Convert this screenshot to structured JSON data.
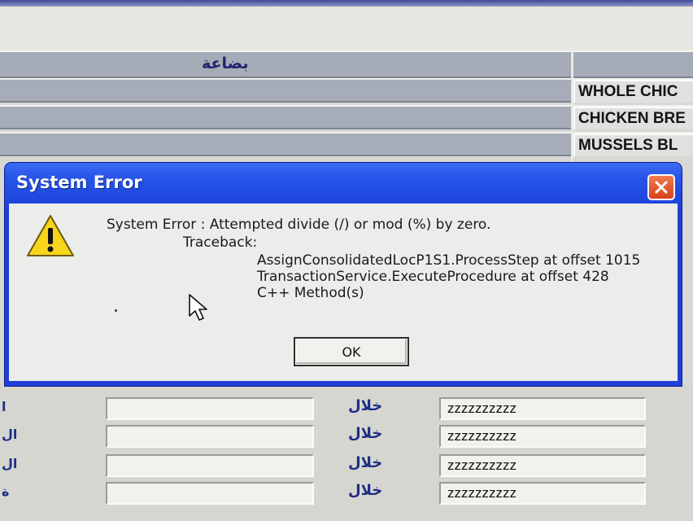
{
  "background_app": {
    "grid_header": "بضاعة",
    "rows": [
      "WHOLE CHIC",
      "CHICKEN BRE",
      "MUSSELS BL"
    ],
    "form_rows": [
      {
        "side_label": "ا",
        "label": "خلال",
        "value": "zzzzzzzzzz"
      },
      {
        "side_label": "ال",
        "label": "خلال",
        "value": "zzzzzzzzzz"
      },
      {
        "side_label": "ال",
        "label": "خلال",
        "value": "zzzzzzzzzz"
      },
      {
        "side_label": "ة",
        "label": "خلال",
        "value": "zzzzzzzzzz"
      }
    ]
  },
  "dialog": {
    "title": "System Error",
    "message": "System Error : Attempted divide (/) or mod (%) by zero.",
    "traceback_label": "Traceback:",
    "traceback": [
      "AssignConsolidatedLocP1S1.ProcessStep at offset 1015",
      "TransactionService.ExecuteProcedure at offset 428",
      "C++ Method(s)"
    ],
    "ok_label": "OK",
    "close_icon": "close-icon",
    "warning_icon": "warning-icon"
  },
  "colors": {
    "title_bar": "#2653e8",
    "close_button": "#e0532a",
    "grid_header": "#a5abb7",
    "label_blue": "#1d2d86"
  }
}
